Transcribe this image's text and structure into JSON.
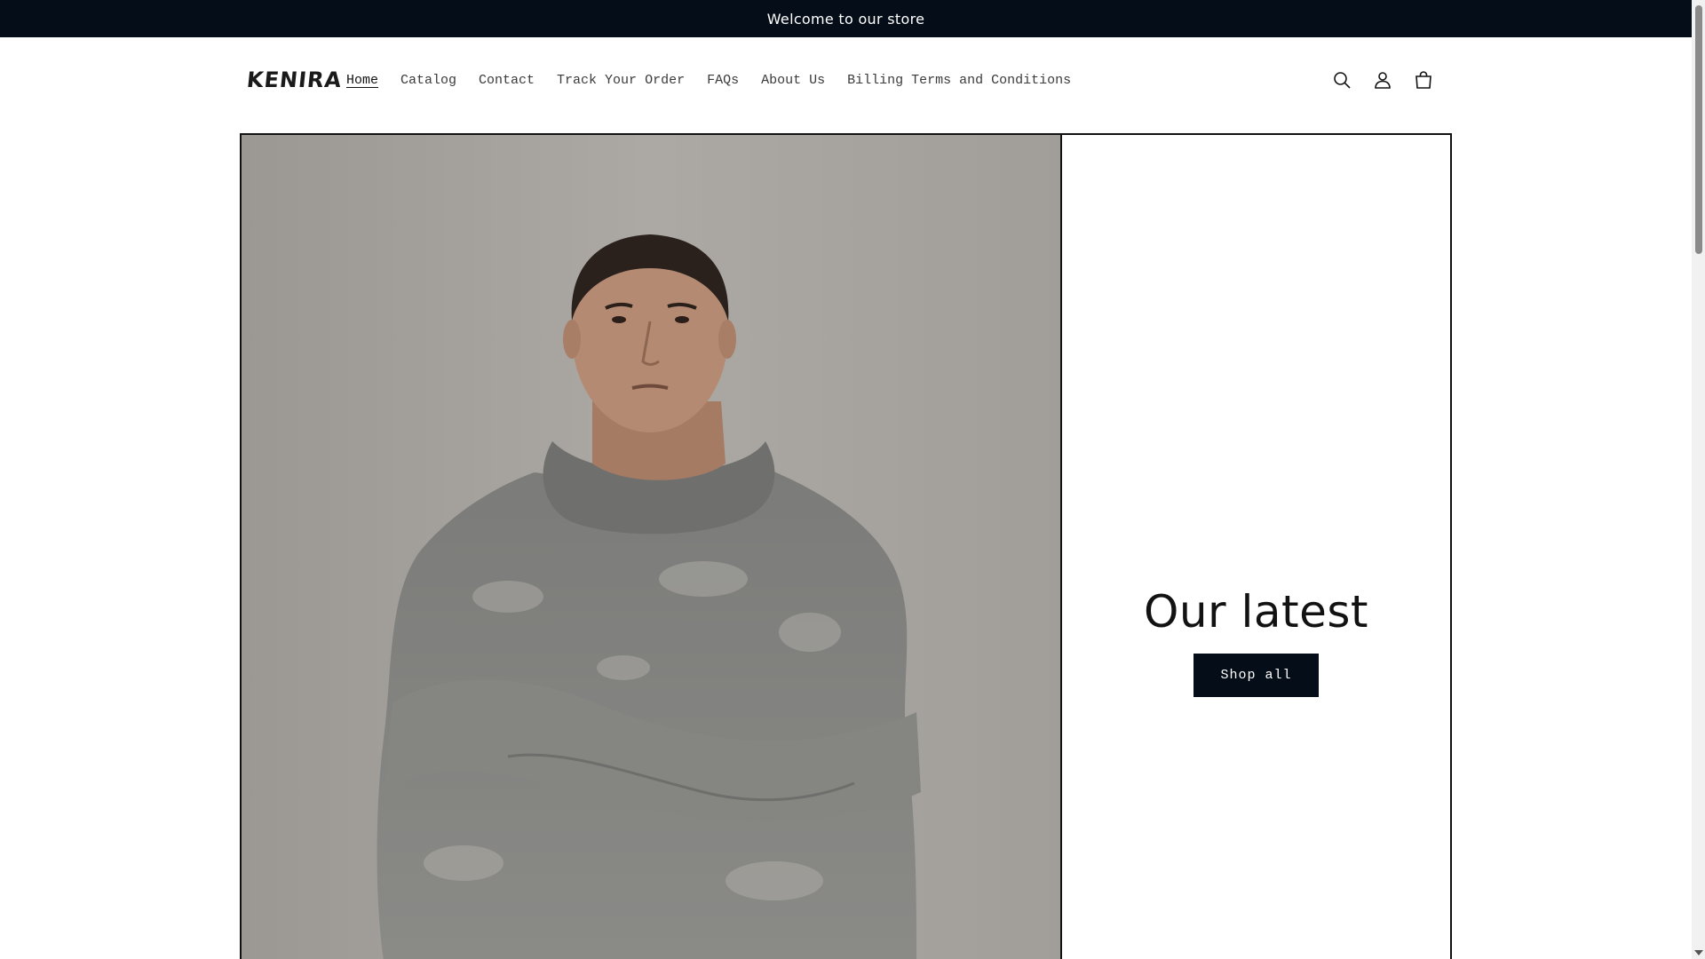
{
  "announcement": {
    "text": "Welcome to our store"
  },
  "header": {
    "logo": "KENIRA",
    "nav": [
      {
        "label": "Home",
        "active": true
      },
      {
        "label": "Catalog"
      },
      {
        "label": "Contact"
      },
      {
        "label": "Track Your Order"
      },
      {
        "label": "FAQs"
      },
      {
        "label": "About Us"
      },
      {
        "label": "Billing Terms and Conditions"
      }
    ],
    "icons": [
      "search-icon",
      "account-icon",
      "cart-icon"
    ]
  },
  "hero": {
    "image": "man-in-grey-hoodie-photo",
    "title": "Our latest",
    "button_label": "Shop all"
  },
  "colors": {
    "announcement_bg": "#050d18",
    "button_bg": "#050d18",
    "text": "#121212"
  }
}
